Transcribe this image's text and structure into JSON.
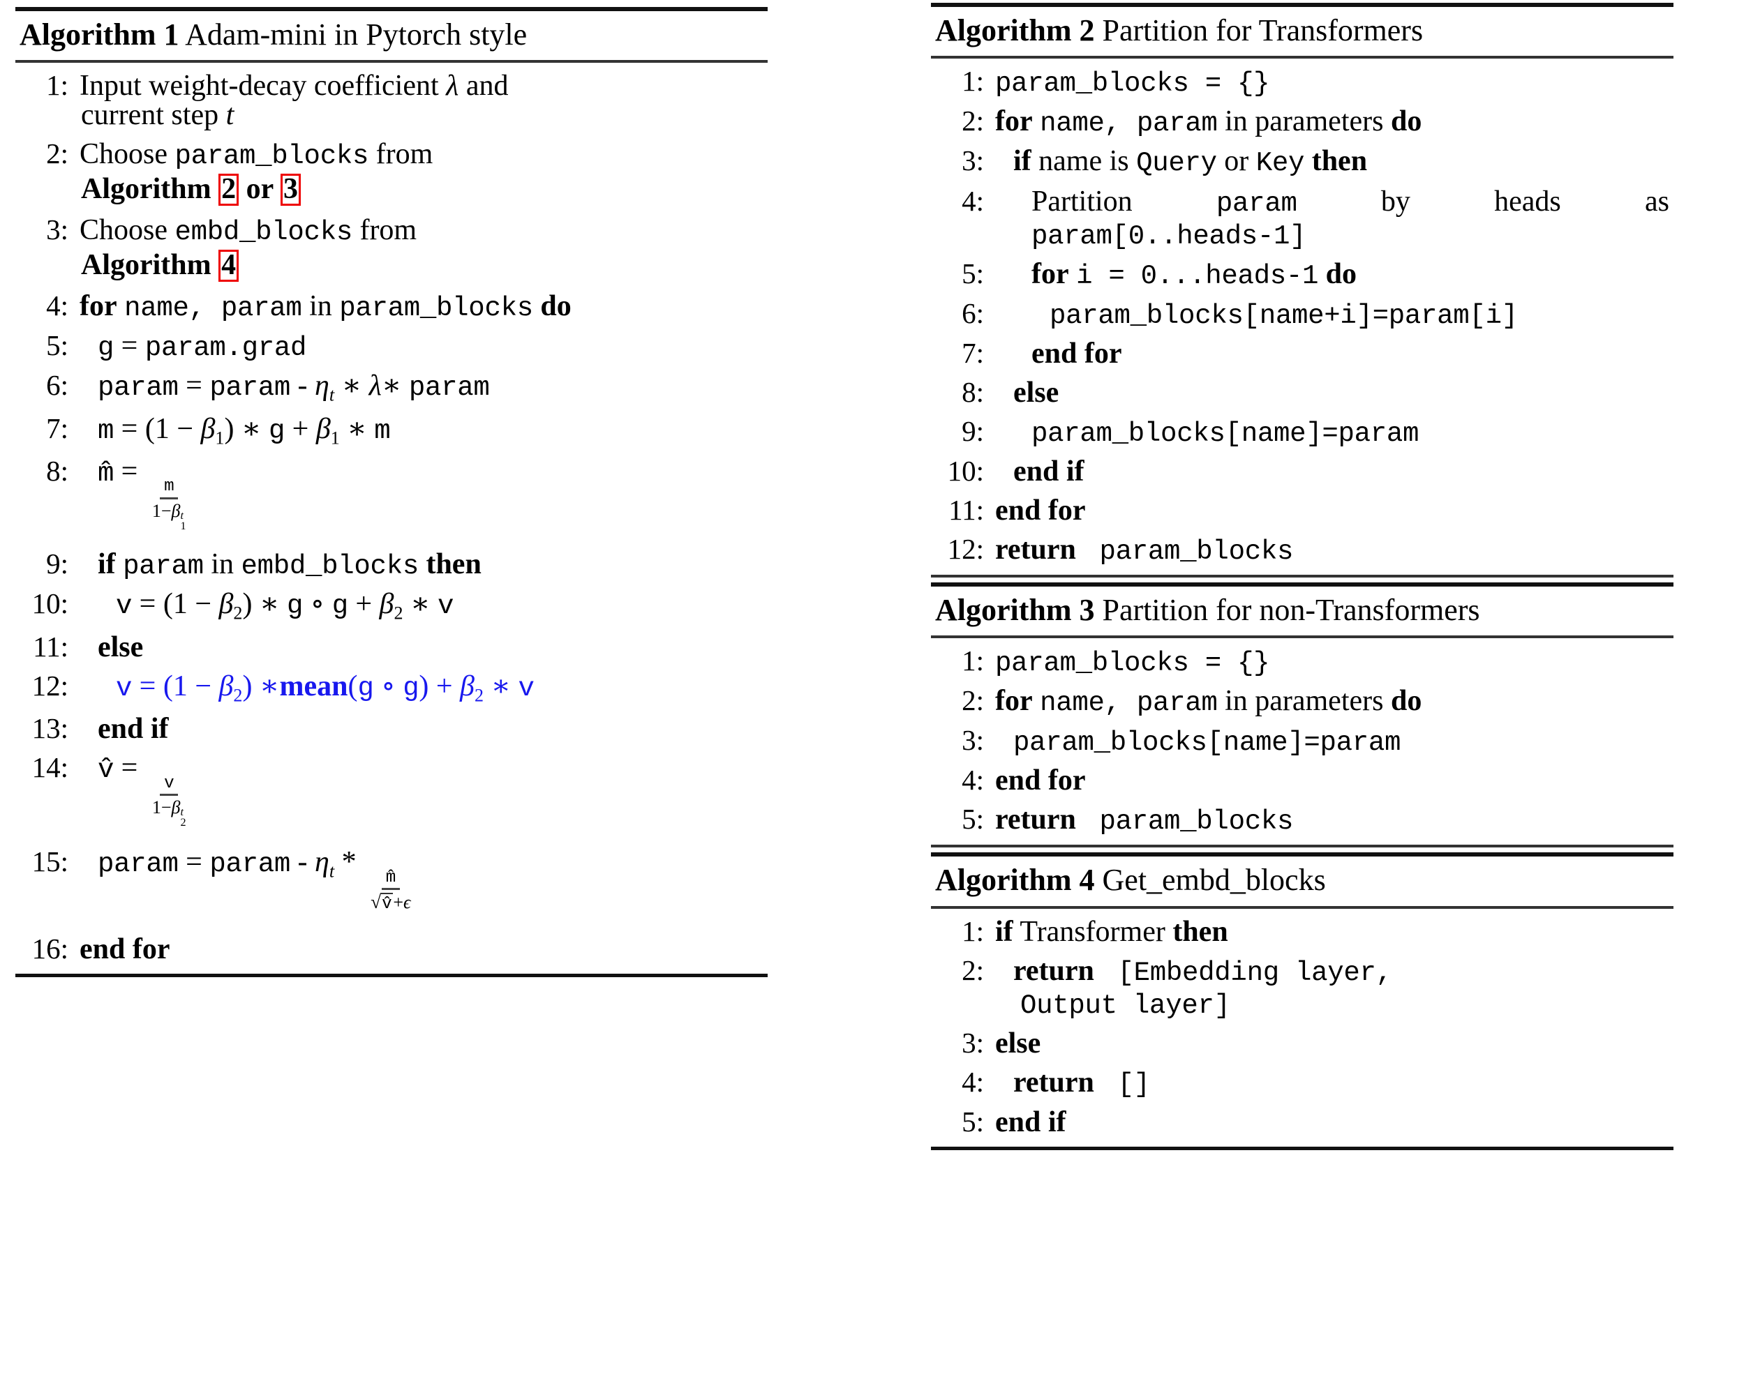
{
  "document": {
    "kind": "latex-algorithm-figure",
    "colors": {
      "reference_box": "#ee0000",
      "highlight_line": "#1818ee",
      "text": "#000000"
    }
  },
  "algorithms": [
    {
      "id": "alg1",
      "label": "Algorithm 1",
      "title": "Adam-mini in Pytorch style",
      "column": "left",
      "lines": [
        {
          "no": "1:",
          "indent": 0,
          "segments": [
            {
              "t": "txt",
              "v": "Input weight-decay coefficient "
            },
            {
              "t": "mi",
              "v": "λ"
            },
            {
              "t": "txt",
              "v": " and"
            }
          ],
          "cont": [
            {
              "t": "txt",
              "v": "current step "
            },
            {
              "t": "mi",
              "v": "t"
            }
          ]
        },
        {
          "no": "2:",
          "indent": 0,
          "segments": [
            {
              "t": "txt",
              "v": "Choose "
            },
            {
              "t": "tt",
              "v": "param_blocks"
            },
            {
              "t": "txt",
              "v": " from"
            }
          ],
          "cont": [
            {
              "t": "kw",
              "v": "Algorithm "
            },
            {
              "t": "ref",
              "v": "2"
            },
            {
              "t": "kw",
              "v": " or "
            },
            {
              "t": "ref",
              "v": "3"
            }
          ]
        },
        {
          "no": "3:",
          "indent": 0,
          "segments": [
            {
              "t": "txt",
              "v": "Choose "
            },
            {
              "t": "tt",
              "v": "embd_blocks"
            },
            {
              "t": "txt",
              "v": " from"
            }
          ],
          "cont": [
            {
              "t": "kw",
              "v": "Algorithm "
            },
            {
              "t": "ref",
              "v": "4"
            }
          ]
        },
        {
          "no": "4:",
          "indent": 0,
          "segments": [
            {
              "t": "kw",
              "v": "for "
            },
            {
              "t": "tt",
              "v": "name, "
            },
            {
              "t": "tt",
              "v": " param"
            },
            {
              "t": "txt",
              "v": " in "
            },
            {
              "t": "tt",
              "v": "param_blocks"
            },
            {
              "t": "kw",
              "v": " do"
            }
          ]
        },
        {
          "no": "5:",
          "indent": 1,
          "segments": [
            {
              "t": "tt",
              "v": "g"
            },
            {
              "t": "txt",
              "v": " = "
            },
            {
              "t": "tt",
              "v": "param.grad"
            }
          ]
        },
        {
          "no": "6:",
          "indent": 1,
          "segments": [
            {
              "t": "tt",
              "v": "param"
            },
            {
              "t": "txt",
              "v": " = "
            },
            {
              "t": "tt",
              "v": "param"
            },
            {
              "t": "txt",
              "v": " - "
            },
            {
              "t": "mi",
              "v": "η"
            },
            {
              "t": "sub",
              "v": "t"
            },
            {
              "t": "txt",
              "v": " ∗ "
            },
            {
              "t": "mi",
              "v": "λ"
            },
            {
              "t": "txt",
              "v": "∗ "
            },
            {
              "t": "tt",
              "v": "param"
            }
          ]
        },
        {
          "no": "7:",
          "indent": 1,
          "segments": [
            {
              "t": "tt",
              "v": "m"
            },
            {
              "t": "txt",
              "v": " = (1 − "
            },
            {
              "t": "mi",
              "v": "β"
            },
            {
              "t": "sub",
              "v": "1"
            },
            {
              "t": "txt",
              "v": ") ∗ "
            },
            {
              "t": "tt",
              "v": "g"
            },
            {
              "t": "txt",
              "v": " + "
            },
            {
              "t": "mi",
              "v": "β"
            },
            {
              "t": "sub",
              "v": "1"
            },
            {
              "t": "txt",
              "v": " ∗ "
            },
            {
              "t": "tt",
              "v": "m"
            }
          ]
        },
        {
          "no": "8:",
          "indent": 1,
          "fraction": {
            "lhs": "m̂ =",
            "num": "m",
            "den_prefix": "1−",
            "den_sym": "β",
            "den_sub": "1",
            "den_sup": "t"
          }
        },
        {
          "no": "9:",
          "indent": 1,
          "segments": [
            {
              "t": "kw",
              "v": "if "
            },
            {
              "t": "tt",
              "v": "param"
            },
            {
              "t": "txt",
              "v": " in "
            },
            {
              "t": "tt",
              "v": "embd_blocks"
            },
            {
              "t": "kw",
              "v": " then"
            }
          ]
        },
        {
          "no": "10:",
          "indent": 2,
          "segments": [
            {
              "t": "tt",
              "v": "v"
            },
            {
              "t": "txt",
              "v": " = (1 − "
            },
            {
              "t": "mi",
              "v": "β"
            },
            {
              "t": "sub",
              "v": "2"
            },
            {
              "t": "txt",
              "v": ") ∗ "
            },
            {
              "t": "tt",
              "v": "g"
            },
            {
              "t": "txt",
              "v": " ∘ "
            },
            {
              "t": "tt",
              "v": "g"
            },
            {
              "t": "txt",
              "v": " + "
            },
            {
              "t": "mi",
              "v": "β"
            },
            {
              "t": "sub",
              "v": "2"
            },
            {
              "t": "txt",
              "v": " ∗ "
            },
            {
              "t": "tt",
              "v": "v"
            }
          ]
        },
        {
          "no": "11:",
          "indent": 1,
          "segments": [
            {
              "t": "kw",
              "v": "else"
            }
          ]
        },
        {
          "no": "12:",
          "indent": 2,
          "blue": true,
          "segments": [
            {
              "t": "tt",
              "v": "v"
            },
            {
              "t": "txt",
              "v": " = (1 − "
            },
            {
              "t": "mi",
              "v": "β"
            },
            {
              "t": "sub",
              "v": "2"
            },
            {
              "t": "txt",
              "v": ") ∗ "
            },
            {
              "t": "kw",
              "v": "mean"
            },
            {
              "t": "txt",
              "v": "("
            },
            {
              "t": "tt",
              "v": "g"
            },
            {
              "t": "txt",
              "v": " ∘ "
            },
            {
              "t": "tt",
              "v": "g"
            },
            {
              "t": "txt",
              "v": ") + "
            },
            {
              "t": "mi",
              "v": "β"
            },
            {
              "t": "sub",
              "v": "2"
            },
            {
              "t": "txt",
              "v": " ∗ "
            },
            {
              "t": "tt",
              "v": "v"
            }
          ]
        },
        {
          "no": "13:",
          "indent": 1,
          "segments": [
            {
              "t": "kw",
              "v": "end if"
            }
          ]
        },
        {
          "no": "14:",
          "indent": 1,
          "fraction": {
            "lhs": "v̂ =",
            "num": "v",
            "den_prefix": "1−",
            "den_sym": "β",
            "den_sub": "2",
            "den_sup": "t"
          }
        },
        {
          "no": "15:",
          "indent": 1,
          "update": {
            "lhs": "param = param - ",
            "eta": "η",
            "eta_sub": "t",
            "star": " * ",
            "num": "m̂",
            "den": "√v̂ + ϵ"
          }
        },
        {
          "no": "16:",
          "indent": 0,
          "segments": [
            {
              "t": "kw",
              "v": "end for"
            }
          ]
        }
      ]
    },
    {
      "id": "alg2",
      "label": "Algorithm 2",
      "title": "Partition for Transformers",
      "column": "right",
      "lines": [
        {
          "no": "1:",
          "indent": 0,
          "segments": [
            {
              "t": "tt",
              "v": "param_blocks = {}"
            }
          ]
        },
        {
          "no": "2:",
          "indent": 0,
          "segments": [
            {
              "t": "kw",
              "v": "for "
            },
            {
              "t": "tt",
              "v": "name, "
            },
            {
              "t": "tt",
              "v": " param"
            },
            {
              "t": "txt",
              "v": " in "
            },
            {
              "t": "txt",
              "v": "parameters"
            },
            {
              "t": "kw",
              "v": " do"
            }
          ]
        },
        {
          "no": "3:",
          "indent": 1,
          "segments": [
            {
              "t": "kw",
              "v": "if "
            },
            {
              "t": "txt",
              "v": "name is "
            },
            {
              "t": "txt",
              "v": "Query"
            },
            {
              "t": "txt",
              "v": " or "
            },
            {
              "t": "txt",
              "v": "Key"
            },
            {
              "t": "kw",
              "v": " then"
            }
          ]
        },
        {
          "no": "4:",
          "indent": 2,
          "justify": true,
          "segments": [
            {
              "t": "txt",
              "v": "Partition "
            },
            {
              "t": "tt",
              "v": "param"
            },
            {
              "t": "txt",
              "v": " by heads as"
            }
          ],
          "cont": [
            {
              "t": "tt",
              "v": "param[0..heads-1]"
            }
          ]
        },
        {
          "no": "5:",
          "indent": 2,
          "segments": [
            {
              "t": "kw",
              "v": "for "
            },
            {
              "t": "tt",
              "v": "i = 0...heads-1"
            },
            {
              "t": "kw",
              "v": " do"
            }
          ]
        },
        {
          "no": "6:",
          "indent": 3,
          "segments": [
            {
              "t": "tt",
              "v": "param_blocks[name+i]=param[i]"
            }
          ]
        },
        {
          "no": "7:",
          "indent": 2,
          "segments": [
            {
              "t": "kw",
              "v": "end for"
            }
          ]
        },
        {
          "no": "8:",
          "indent": 1,
          "segments": [
            {
              "t": "kw",
              "v": "else"
            }
          ]
        },
        {
          "no": "9:",
          "indent": 2,
          "segments": [
            {
              "t": "tt",
              "v": "param_blocks[name]=param"
            }
          ]
        },
        {
          "no": "10:",
          "indent": 1,
          "segments": [
            {
              "t": "kw",
              "v": "end if"
            }
          ]
        },
        {
          "no": "11:",
          "indent": 0,
          "segments": [
            {
              "t": "kw",
              "v": "end for"
            }
          ]
        },
        {
          "no": "12:",
          "indent": 0,
          "segments": [
            {
              "t": "kw",
              "v": "return "
            },
            {
              "t": "tt",
              "v": " param_blocks"
            }
          ]
        }
      ]
    },
    {
      "id": "alg3",
      "label": "Algorithm 3",
      "title": "Partition for non-Transformers",
      "column": "right",
      "lines": [
        {
          "no": "1:",
          "indent": 0,
          "segments": [
            {
              "t": "tt",
              "v": "param_blocks = {}"
            }
          ]
        },
        {
          "no": "2:",
          "indent": 0,
          "segments": [
            {
              "t": "kw",
              "v": "for "
            },
            {
              "t": "tt",
              "v": "name, "
            },
            {
              "t": "tt",
              "v": " param"
            },
            {
              "t": "txt",
              "v": " in "
            },
            {
              "t": "txt",
              "v": "parameters"
            },
            {
              "t": "kw",
              "v": " do"
            }
          ]
        },
        {
          "no": "3:",
          "indent": 1,
          "segments": [
            {
              "t": "tt",
              "v": "param_blocks[name]=param"
            }
          ]
        },
        {
          "no": "4:",
          "indent": 0,
          "segments": [
            {
              "t": "kw",
              "v": "end for"
            }
          ]
        },
        {
          "no": "5:",
          "indent": 0,
          "segments": [
            {
              "t": "kw",
              "v": "return "
            },
            {
              "t": "tt",
              "v": " param_blocks"
            }
          ]
        }
      ]
    },
    {
      "id": "alg4",
      "label": "Algorithm 4",
      "title": "Get_embd_blocks",
      "column": "right",
      "lines": [
        {
          "no": "1:",
          "indent": 0,
          "segments": [
            {
              "t": "kw",
              "v": "if "
            },
            {
              "t": "txt",
              "v": "Transformer"
            },
            {
              "t": "kw",
              "v": " then"
            }
          ]
        },
        {
          "no": "2:",
          "indent": 1,
          "segments": [
            {
              "t": "kw",
              "v": "return "
            },
            {
              "t": "tt",
              "v": " [Embedding layer,"
            }
          ],
          "cont": [
            {
              "t": "tt",
              "v": "Output layer]"
            }
          ]
        },
        {
          "no": "3:",
          "indent": 0,
          "segments": [
            {
              "t": "kw",
              "v": "else"
            }
          ]
        },
        {
          "no": "4:",
          "indent": 1,
          "segments": [
            {
              "t": "kw",
              "v": "return "
            },
            {
              "t": "tt",
              "v": " []"
            }
          ]
        },
        {
          "no": "5:",
          "indent": 0,
          "segments": [
            {
              "t": "kw",
              "v": "end if"
            }
          ]
        }
      ]
    }
  ]
}
